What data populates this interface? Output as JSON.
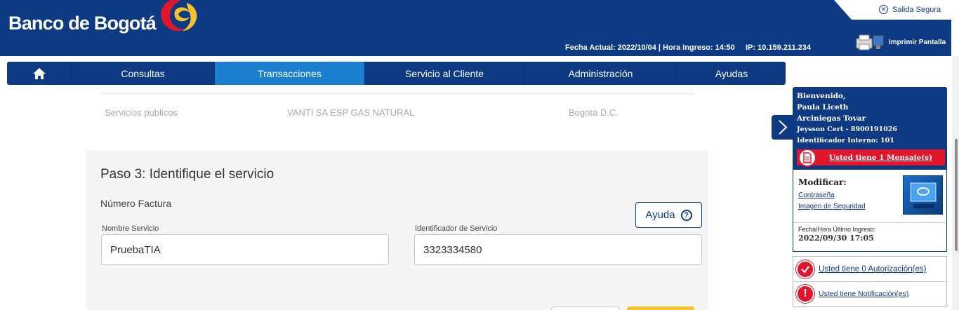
{
  "brand": {
    "name": "Banco de Bogotá"
  },
  "header": {
    "fecha_info": "Fecha Actual: 2022/10/04 | Hora Ingreso: 14:50",
    "ip_info": "IP: 10.159.211.234",
    "salida_label": "Salida Segura",
    "print_label": "Imprimir Pantalla"
  },
  "nav": {
    "home_icon": "home-icon",
    "items": [
      {
        "label": "Consultas"
      },
      {
        "label": "Transacciones",
        "active": true
      },
      {
        "label": "Servicio al Cliente"
      },
      {
        "label": "Administración"
      },
      {
        "label": "Ayudas"
      }
    ]
  },
  "service_row": {
    "type": "Servicios publicos",
    "company": "VANTI SA ESP GAS NATURAL",
    "city": "Bogota D.C."
  },
  "step": {
    "title": "Paso 3: Identifique el servicio",
    "subtitle": "Número Factura",
    "help_label": "Ayuda",
    "help_icon": "?",
    "fields": [
      {
        "label": "Nombre Servicio",
        "value": "PruebaTIA"
      },
      {
        "label": "Identificador de Servicio",
        "value": "3323334580"
      }
    ]
  },
  "user": {
    "greeting": "Bienvenido,",
    "name_line1": "Paula Liceth",
    "name_line2": "Arciniegas Tovar",
    "company": "Jeysson Cert - 8900191026",
    "internal_id": "Identificador Interno: 101",
    "messages": "Usted tiene 1 Mensaje(s)"
  },
  "modify": {
    "title": "Modificar:",
    "links": [
      "Contraseña",
      "Imagen de Seguridad"
    ],
    "last_login_label": "Fecha/Hora Último Ingreso:",
    "last_login": "2022/09/30 17:05"
  },
  "notifications": {
    "authorizations": "Usted tiene 0 Autorización(es)",
    "notifications": "Usted tiene Notificación(es)",
    "icon_glyph": "!"
  },
  "colors": {
    "primary": "#0e3a84",
    "active_tab": "#1a7fcf",
    "alert": "#e0162b",
    "accent_yellow": "#f6c22b"
  }
}
